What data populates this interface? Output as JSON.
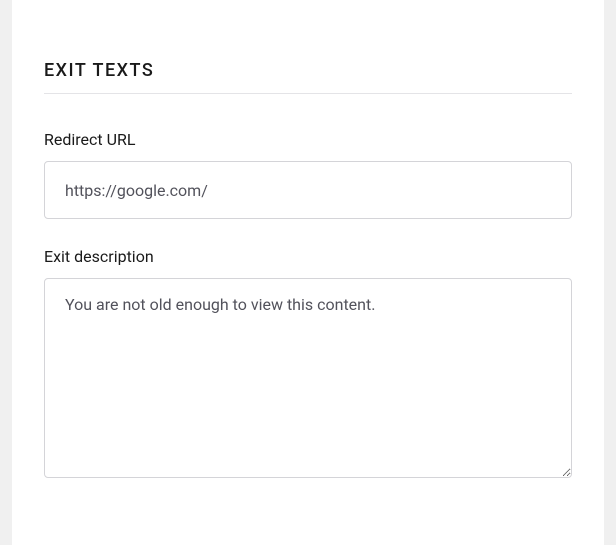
{
  "section": {
    "title": "EXIT TEXTS"
  },
  "fields": {
    "redirect_url": {
      "label": "Redirect URL",
      "value": "https://google.com/"
    },
    "exit_description": {
      "label": "Exit description",
      "value": "You are not old enough to view this content."
    }
  }
}
